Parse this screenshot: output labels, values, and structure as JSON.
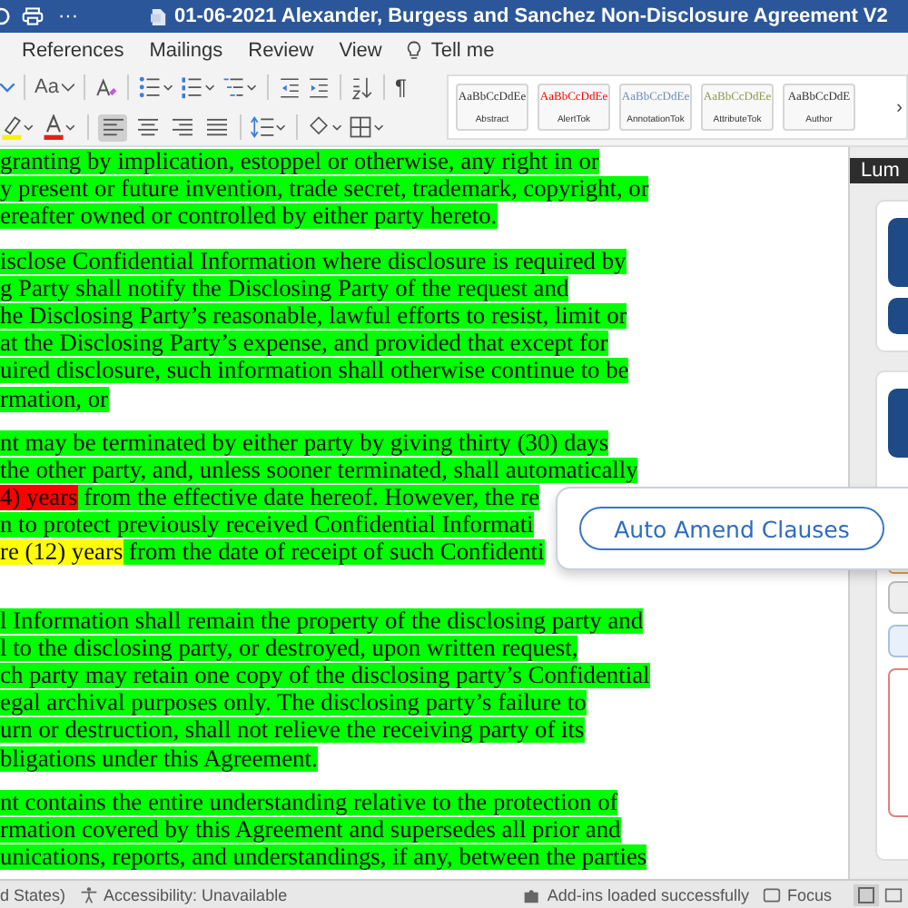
{
  "title_bar": {
    "title": "01-06-2021 Alexander, Burgess and Sanchez Non-Disclosure Agreement V2",
    "more": "···"
  },
  "menu": [
    {
      "label": "References"
    },
    {
      "label": "Mailings"
    },
    {
      "label": "Review"
    },
    {
      "label": "View"
    }
  ],
  "tell_me": "Tell me",
  "ribbon": {
    "change_case": "Aa",
    "pilcrow": "¶",
    "alignment_buttons": [
      {
        "selected": true
      },
      {
        "selected": false
      },
      {
        "selected": false
      },
      {
        "selected": false
      }
    ],
    "styles": [
      {
        "sample": "AaBbCcDdEe",
        "name": "Abstract",
        "color": "#333333"
      },
      {
        "sample": "AaBbCcDdEe",
        "name": "AlertTok",
        "color": "#ff0000"
      },
      {
        "sample": "AaBbCcDdEe",
        "name": "AnnotationTok",
        "color": "#6a8fb5"
      },
      {
        "sample": "AaBbCcDdEe",
        "name": "AttributeTok",
        "color": "#8a9a4a"
      },
      {
        "sample": "AaBbCcDdE",
        "name": "Author",
        "color": "#333333"
      }
    ],
    "gallery_next": "›"
  },
  "document": {
    "paragraphs": [
      {
        "lines": [
          [
            {
              "text": "granting by implication, estoppel or otherwise, any right in or",
              "color": "#00ff00"
            }
          ],
          [
            {
              "text": "y present or future invention, trade secret, trademark, copyright, or",
              "color": "#00ff00"
            }
          ],
          [
            {
              "text": "ereafter owned or controlled by either party hereto.",
              "color": "#00ff00"
            }
          ]
        ]
      },
      {
        "lines": [
          [
            {
              "text": "isclose Confidential Information where disclosure is required by",
              "color": "#00ff00"
            }
          ],
          [
            {
              "text": "g Party shall notify the Disclosing Party of the request and",
              "color": "#00ff00"
            }
          ],
          [
            {
              "text": "he Disclosing Party’s reasonable, lawful efforts to resist, limit or",
              "color": "#00ff00"
            }
          ],
          [
            {
              "text": "at the Disclosing Party’s expense, and provided that except for",
              "color": "#00ff00"
            }
          ],
          [
            {
              "text": "uired disclosure, such information shall otherwise continue to be",
              "color": "#00ff00"
            }
          ],
          [
            {
              "text": "rmation, or",
              "color": "#00ff00"
            }
          ]
        ]
      },
      {
        "lines": [
          [
            {
              "text": "nt may be terminated by either party by giving thirty (30) days",
              "color": "#00ff00"
            }
          ],
          [
            {
              "text": "the other party, and, unless sooner terminated, shall automatically",
              "color": "#00ff00"
            }
          ],
          [
            {
              "text": "4) years",
              "color": "#ff0000"
            },
            {
              "text": " from the effective date hereof. However, the re",
              "color": "#00ff00"
            }
          ],
          [
            {
              "text": "n to protect previously received Confidential Informati",
              "color": "#00ff00"
            }
          ],
          [
            {
              "text": "re (12) years",
              "color": "#ffff00"
            },
            {
              "text": " from the date of receipt of such Confidenti",
              "color": "#00ff00"
            }
          ]
        ]
      },
      {
        "lines": [
          [
            {
              "text": "l Information shall remain the property of the disclosing party and",
              "color": "#00ff00"
            }
          ],
          [
            {
              "text": "l to the disclosing party, or destroyed, upon written request,",
              "color": "#00ff00"
            }
          ],
          [
            {
              "text": "ch party may retain one copy of the disclosing party’s Confidential",
              "color": "#00ff00"
            }
          ],
          [
            {
              "text": "egal archival purposes only. The disclosing party’s failure to",
              "color": "#00ff00"
            }
          ],
          [
            {
              "text": "urn or destruction, shall not relieve the receiving party of its",
              "color": "#00ff00"
            }
          ],
          [
            {
              "text": "bligations under this Agreement.",
              "color": "#00ff00"
            }
          ]
        ]
      },
      {
        "lines": [
          [
            {
              "text": "nt contains the entire understanding relative to the protection of",
              "color": "#00ff00"
            }
          ],
          [
            {
              "text": "rmation covered by this Agreement and supersedes all prior and",
              "color": "#00ff00"
            }
          ],
          [
            {
              "text": "unications, reports, and understandings, if any, between the parties",
              "color": "#00ff00"
            }
          ]
        ]
      }
    ]
  },
  "side_pane": {
    "header": "Lum"
  },
  "popup": {
    "button": "Auto Amend Clauses"
  },
  "status_bar": [
    {
      "kind": "text",
      "label": "d States)"
    },
    {
      "kind": "accessibility",
      "label": "Accessibility: Unavailable"
    },
    {
      "kind": "addins",
      "label": "Add-ins loaded successfully"
    },
    {
      "kind": "focus",
      "label": "Focus"
    }
  ]
}
